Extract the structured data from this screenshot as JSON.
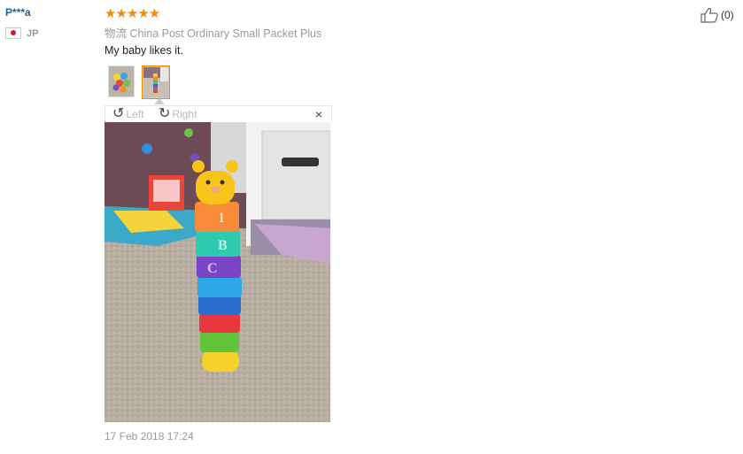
{
  "reviewer": {
    "name": "P***a",
    "country": "JP",
    "flag_icon": "japan-flag-icon"
  },
  "rating": {
    "stars": 5,
    "max": 5,
    "glyphs": "★★★★★"
  },
  "logistics": {
    "label": "物流",
    "value": "China Post Ordinary Small Packet Plus"
  },
  "review_text": "My baby likes it.",
  "images": {
    "count": 2,
    "selected_index": 1
  },
  "viewer": {
    "rotate_left": "Left",
    "rotate_right": "Right",
    "close_glyph": "×"
  },
  "date": "17 Feb 2018 17:24",
  "helpful": {
    "count_text": "(0)",
    "icon": "thumbs-up-icon"
  },
  "colors": {
    "username": "#1f5d9b",
    "stars": "#f28a0a",
    "selected_border": "#f28a0a",
    "muted_text": "#999999"
  }
}
